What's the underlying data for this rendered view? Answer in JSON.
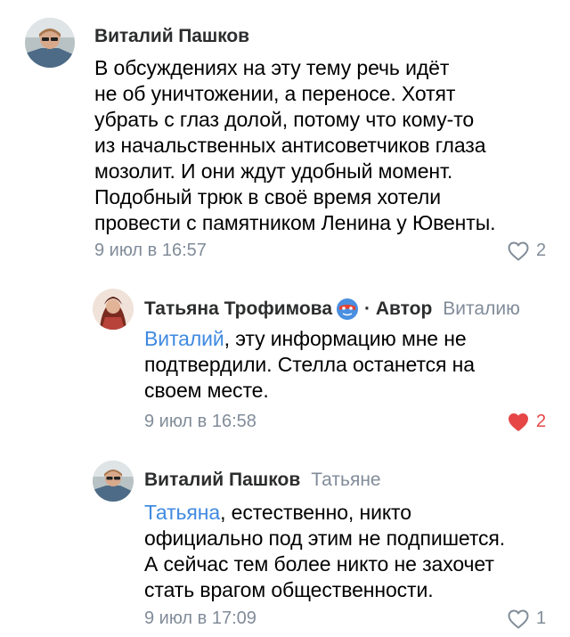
{
  "comments": [
    {
      "author": "Виталий Пашков",
      "lines": [
        "В обсуждениях на эту тему речь идёт",
        "не об уничтожении, а переносе. Хотят",
        "убрать с глаз долой, потому что кому-то",
        "из начальственных антисоветчиков глаза",
        "мозолит. И они ждут удобный момент.",
        "Подобный трюк в своё время хотели",
        "провести с памятником Ленина у Ювенты."
      ],
      "time": "9 июл в 16:57",
      "likes": "2",
      "liked": false
    },
    {
      "author": "Татьяна Трофимова",
      "author_label": "· Автор",
      "reply_to": "Виталию",
      "badge_icon": "superhero-mask-icon",
      "mention": "Виталий",
      "lines_first_rest": ", эту информацию мне не",
      "lines": [
        "подтвердили. Стелла останется на",
        "своем месте."
      ],
      "time": "9 июл в 16:58",
      "likes": "2",
      "liked": true
    },
    {
      "author": "Виталий Пашков",
      "reply_to": "Татьяне",
      "mention": "Татьяна",
      "lines_first_rest": ", естественно, никто",
      "lines": [
        "официально под этим не подпишется.",
        "А сейчас тем более никто не захочет",
        "стать врагом общественности."
      ],
      "time": "9 июл в 17:09",
      "likes": "1",
      "liked": false
    }
  ],
  "colors": {
    "mention": "#3f8ae0",
    "secondary_text": "#818c99",
    "like_active": "#e64646"
  }
}
